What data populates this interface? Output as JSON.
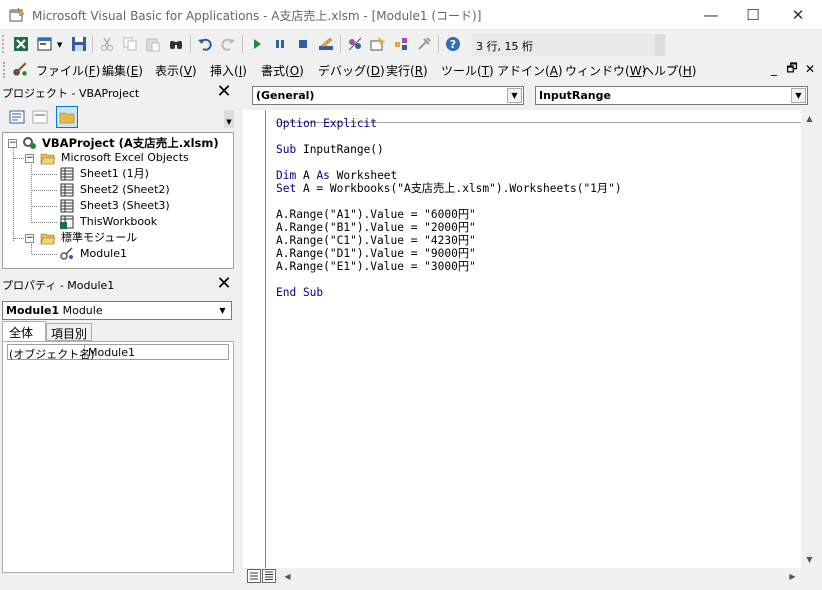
{
  "window": {
    "title": "Microsoft Visual Basic for Applications - A支店売上.xlsm - [Module1 (コード)]",
    "minimize": "—",
    "maximize": "☐",
    "close": "✕"
  },
  "toolbar": {
    "cursor_position": "3 行, 15 桁",
    "icons": [
      "excel-icon",
      "insert-userform-icon",
      "save-icon",
      "cut-icon",
      "copy-icon",
      "paste-icon",
      "find-icon",
      "undo-icon",
      "redo-icon",
      "run-icon",
      "break-icon",
      "reset-icon",
      "design-mode-icon",
      "project-explorer-icon",
      "properties-icon",
      "object-browser-icon",
      "toolbox-icon",
      "help-icon"
    ]
  },
  "menubar": {
    "items": [
      {
        "label": "ファイル(",
        "key": "F",
        "end": ")"
      },
      {
        "label": "編集(",
        "key": "E",
        "end": ")"
      },
      {
        "label": "表示(",
        "key": "V",
        "end": ")"
      },
      {
        "label": "挿入(",
        "key": "I",
        "end": ")"
      },
      {
        "label": "書式(",
        "key": "O",
        "end": ")"
      },
      {
        "label": "デバッグ(",
        "key": "D",
        "end": ")"
      },
      {
        "label": "実行(",
        "key": "R",
        "end": ")"
      },
      {
        "label": "ツール(",
        "key": "T",
        "end": ")"
      },
      {
        "label": "アドイン(",
        "key": "A",
        "end": ")"
      },
      {
        "label": "ウィンドウ(",
        "key": "W",
        "end": ")"
      },
      {
        "label": "ヘルプ(",
        "key": "H",
        "end": ")"
      }
    ],
    "mdi_min": "_",
    "mdi_restore": "🗗",
    "mdi_close": "✕"
  },
  "project_pane": {
    "title": "プロジェクト - VBAProject",
    "close": "✕",
    "tree": {
      "project": "VBAProject (A支店売上.xlsm)",
      "excel_objects": "Microsoft Excel Objects",
      "sheets": [
        "Sheet1 (1月)",
        "Sheet2 (Sheet2)",
        "Sheet3 (Sheet3)"
      ],
      "workbook": "ThisWorkbook",
      "modules_folder": "標準モジュール",
      "module": "Module1",
      "collapse_glyph": "−"
    }
  },
  "properties_pane": {
    "title": "プロパティ - Module1",
    "close": "✕",
    "object_name": "Module1",
    "object_type": "Module",
    "tabs": [
      "全体",
      "項目別"
    ],
    "rows": [
      {
        "name": "(オブジェクト名)",
        "value": "Module1"
      }
    ]
  },
  "code_window": {
    "object_combo": "(General)",
    "proc_combo": "InputRange",
    "lines": [
      {
        "kw": "Option Explicit",
        "text": ""
      },
      {
        "kw": "",
        "text": ""
      },
      {
        "kw": "Sub ",
        "text": "InputRange()"
      },
      {
        "kw": "",
        "text": ""
      },
      {
        "kw": "Dim ",
        "text": "A ",
        "kw2": "As ",
        "text2": "Worksheet"
      },
      {
        "kw": "Set ",
        "text": "A = Workbooks(\"A支店売上.xlsm\").Worksheets(\"1月\")"
      },
      {
        "kw": "",
        "text": ""
      },
      {
        "kw": "",
        "text": "A.Range(\"A1\").Value = \"6000円\""
      },
      {
        "kw": "",
        "text": "A.Range(\"B1\").Value = \"2000円\""
      },
      {
        "kw": "",
        "text": "A.Range(\"C1\").Value = \"4230円\""
      },
      {
        "kw": "",
        "text": "A.Range(\"D1\").Value = \"9000円\""
      },
      {
        "kw": "",
        "text": "A.Range(\"E1\").Value = \"3000円\""
      },
      {
        "kw": "",
        "text": ""
      },
      {
        "kw": "End Sub",
        "text": ""
      }
    ]
  },
  "colors": {
    "keyword": "#00008b",
    "accent": "#0078d7"
  }
}
